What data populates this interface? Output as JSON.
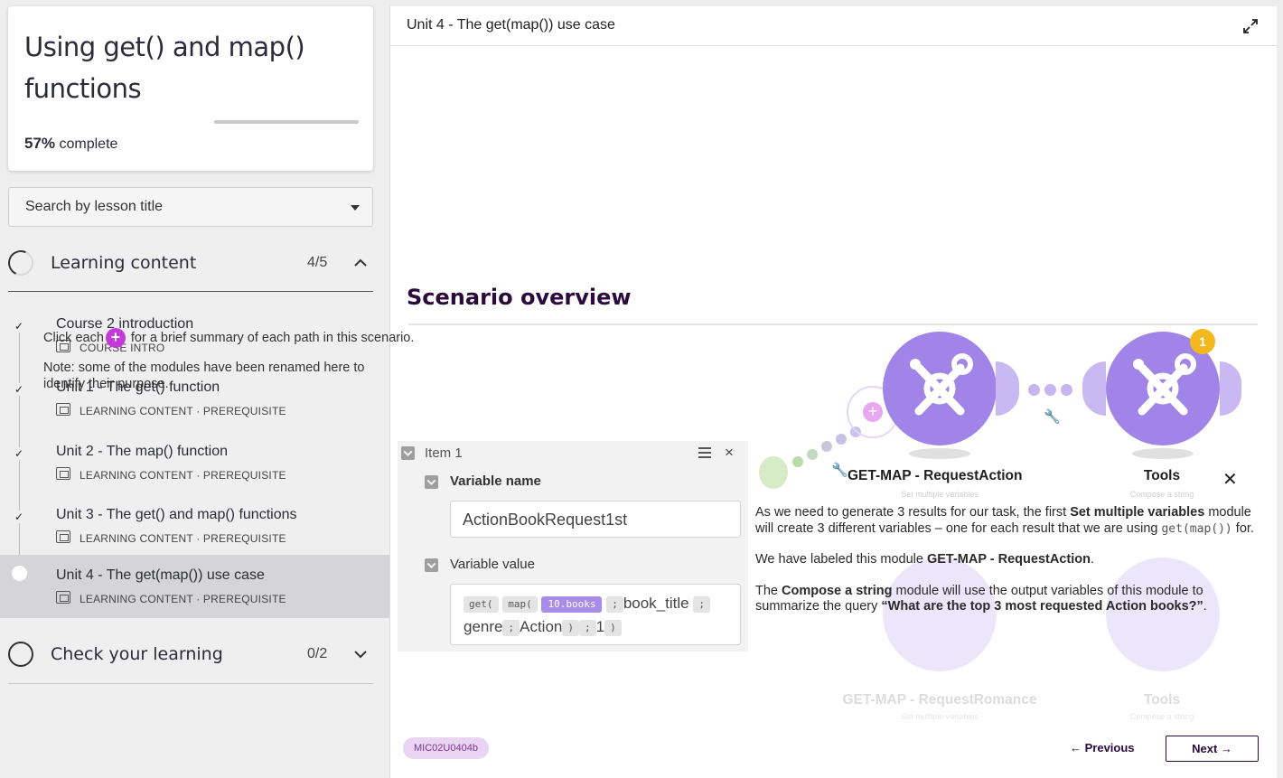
{
  "course": {
    "title": "Using get() and map() functions",
    "progress_percent": 57,
    "progress_value": "57%",
    "progress_suffix": "complete"
  },
  "search": {
    "placeholder": "Search by lesson title"
  },
  "sections": [
    {
      "label": "Learning content",
      "count": "4/5",
      "expanded": true
    },
    {
      "label": "Check your learning",
      "count": "0/2",
      "expanded": false
    }
  ],
  "lessons": [
    {
      "name": "Course 2 introduction",
      "meta": "COURSE INTRO",
      "done": true
    },
    {
      "name": "Unit 1 - The get() function",
      "meta": "LEARNING CONTENT · PREREQUISITE",
      "done": true
    },
    {
      "name": "Unit 2 - The map() function",
      "meta": "LEARNING CONTENT · PREREQUISITE",
      "done": true
    },
    {
      "name": "Unit 3 - The get() and map() functions",
      "meta": "LEARNING CONTENT · PREREQUISITE",
      "done": true
    },
    {
      "name": "Unit 4 - The get(map()) use case",
      "meta": "LEARNING CONTENT · PREREQUISITE",
      "done": false,
      "active": true
    }
  ],
  "main": {
    "header_title": "Unit 4 - The get(map()) use case",
    "scenario_title": "Scenario overview",
    "intro_before": "Click each",
    "intro_after": "for a brief summary of each path in this scenario.",
    "note_label": "Note:",
    "note_text": "some of the modules have been renamed here to identify their purpose."
  },
  "diagram": {
    "module1_label": "GET-MAP - RequestAction",
    "module1_sub": "Set multiple variables",
    "module2_label": "Tools",
    "module2_sub": "Compose a string",
    "module3_label": "GET-MAP - RequestRomance",
    "module3_sub": "Set multiple variables",
    "module4_label": "Tools",
    "module4_sub": "Compose a string",
    "badge": "1",
    "accent": "#a184e8"
  },
  "item_panel": {
    "title": "Item 1",
    "var_name_label": "Variable name",
    "var_name_value": "ActionBookRequest1st",
    "var_value_label": "Variable value",
    "tokens": {
      "get": "get(",
      "map": "map(",
      "books": "10.books",
      "sep": ";",
      "book_title": "book_title",
      "genre": "genre",
      "action": "Action",
      "close": ")",
      "one": "1"
    }
  },
  "description": {
    "p1_a": "As we need to generate 3 results for our task, the first",
    "p1_b": "Set multiple variables",
    "p1_c": "module will create 3 different variables – one for each result that we are using",
    "p1_code": "get(map())",
    "p1_d": "for.",
    "p2_a": "We have labeled this module",
    "p2_b": "GET-MAP - RequestAction",
    "p2_c": ".",
    "p3_a": "The",
    "p3_b": "Compose a string",
    "p3_c": "module will use the output variables of this module to summarize the query",
    "p3_d": "“What are the top 3 most requested Action books?”",
    "p3_e": "."
  },
  "footer": {
    "code": "MIC02U0404b",
    "prev_label": "← Previous",
    "next_label": "Next →"
  }
}
